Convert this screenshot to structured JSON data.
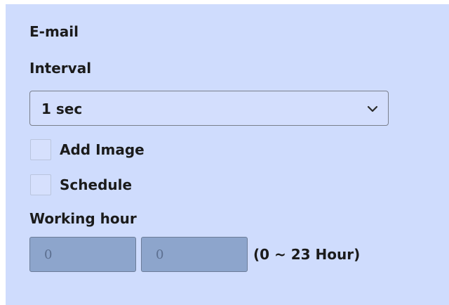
{
  "email": {
    "title": "E-mail",
    "interval_label": "Interval",
    "interval_select": {
      "selected": "1 sec",
      "icon": "chevron-down-icon"
    },
    "add_image": {
      "label": "Add Image",
      "checked": false
    },
    "schedule": {
      "label": "Schedule",
      "checked": false
    },
    "working_hour": {
      "label": "Working hour",
      "start": "0",
      "end": "0",
      "range_hint": "(0 ~ 23 Hour)"
    }
  },
  "colors": {
    "panel_bg": "#cfdcfd",
    "disabled_input_bg": "#8da5cc",
    "text": "#1b1b1b"
  }
}
